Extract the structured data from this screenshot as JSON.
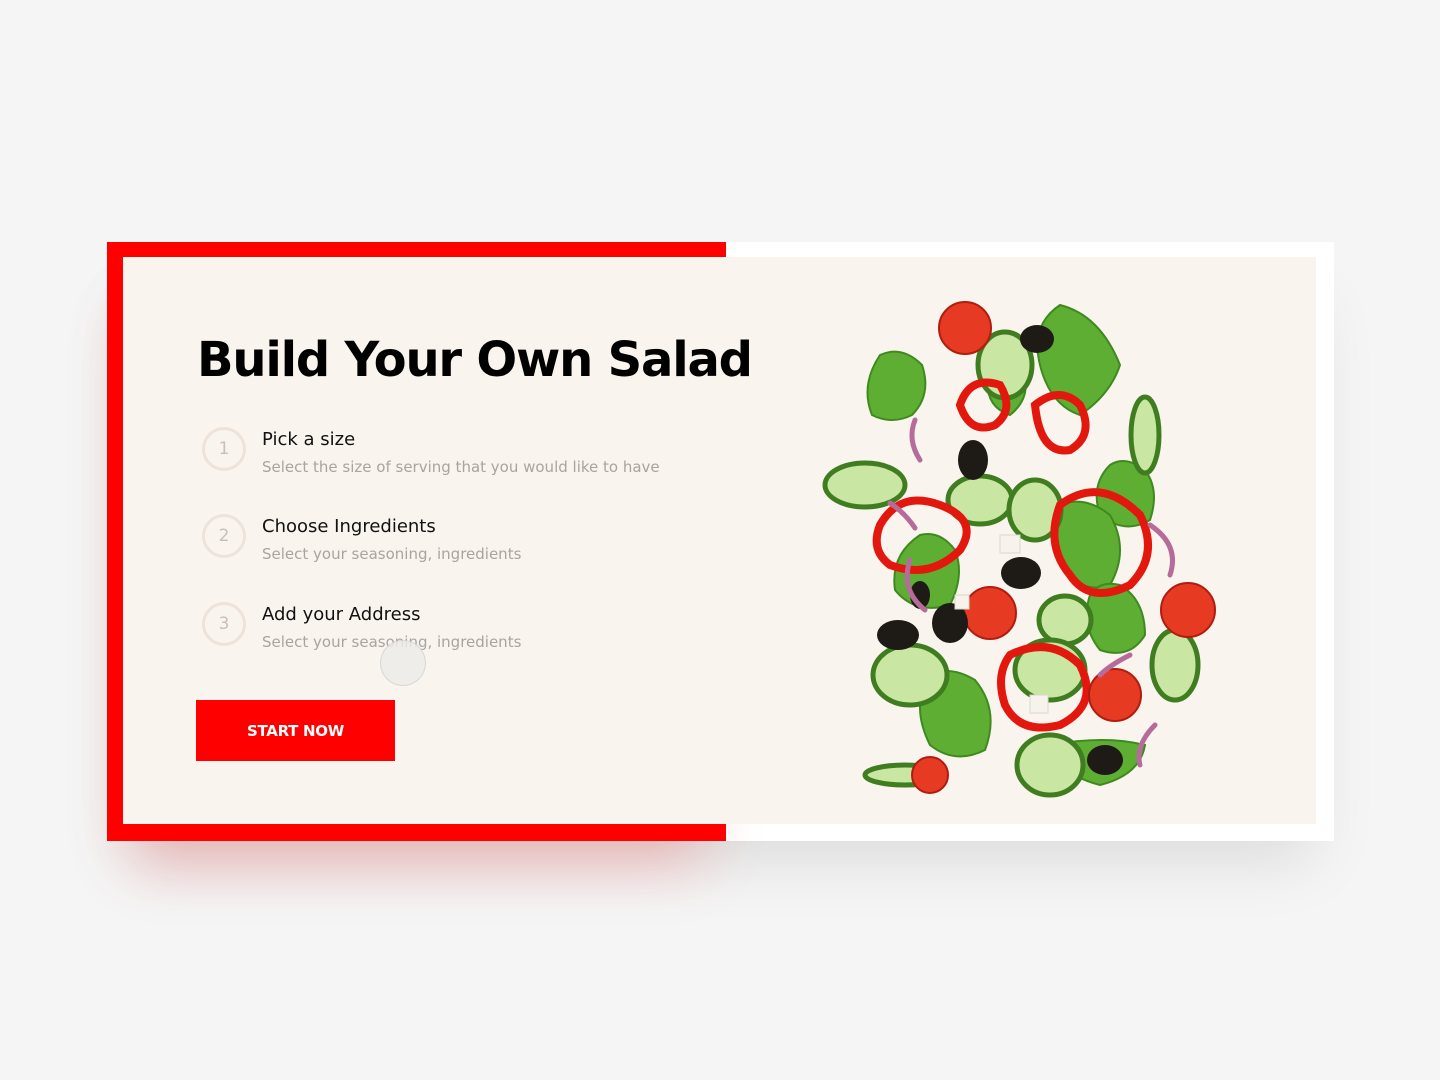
{
  "hero": {
    "title": "Build Your Own Salad",
    "steps": [
      {
        "number": "1",
        "title": "Pick a size",
        "description": "Select the size of serving that you would like to have"
      },
      {
        "number": "2",
        "title": "Choose Ingredients",
        "description": "Select your seasoning, ingredients"
      },
      {
        "number": "3",
        "title": "Add your Address",
        "description": "Select your seasoning, ingredients"
      }
    ],
    "cta_label": "START NOW",
    "image_subject": "flying-salad-illustration"
  },
  "colors": {
    "accent": "#ff0000",
    "panel": "#faf4ee",
    "page_background": "#f5f5f5",
    "step_circle": "#ede3d9",
    "description_text": "#a8a4a0"
  }
}
